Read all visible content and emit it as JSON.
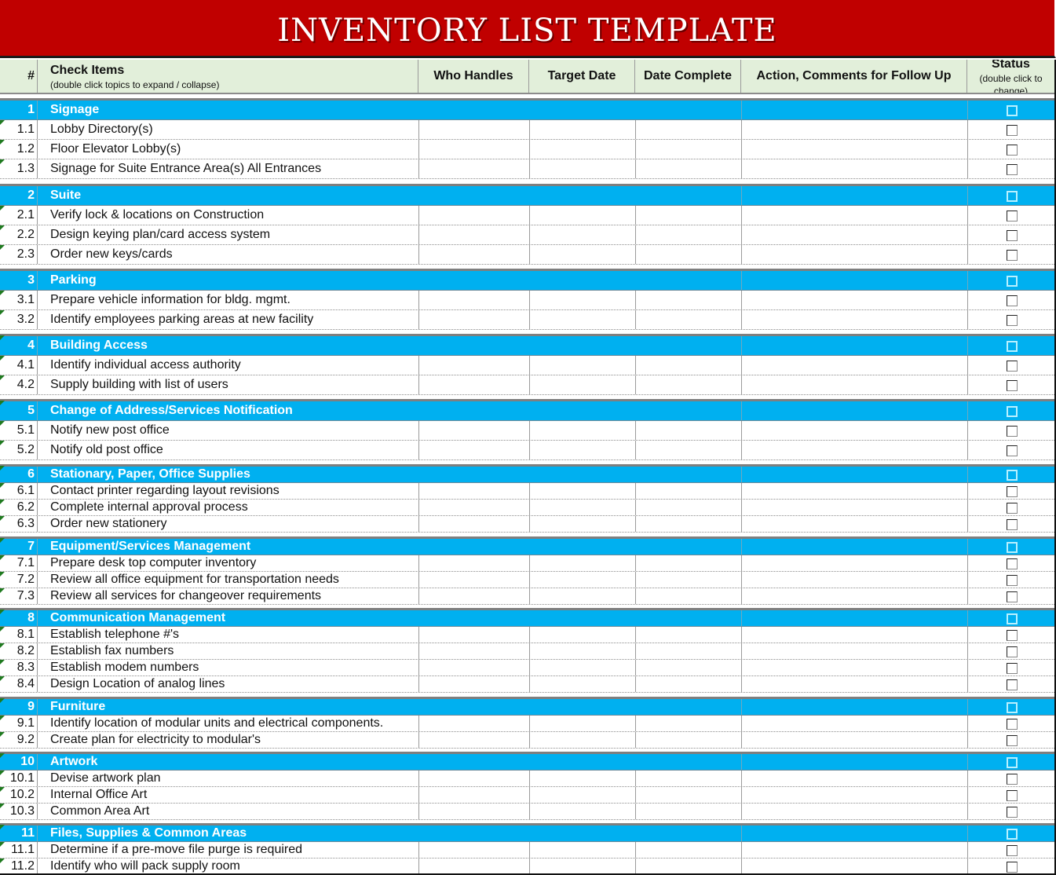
{
  "title": "INVENTORY LIST TEMPLATE",
  "header": {
    "num": "#",
    "check_items": "Check Items",
    "check_items_hint": "(double click topics to expand / collapse)",
    "who_handles": "Who Handles",
    "target_date": "Target Date",
    "date_complete": "Date Complete",
    "action": "Action, Comments for Follow Up",
    "status": "Status",
    "status_hint": "(double click to change)"
  },
  "colors": {
    "title_band": "#C00000",
    "header_bg": "#E2EFDA",
    "section_bg": "#00B0F0",
    "comment_marker": "#1F7A1F"
  },
  "sections": [
    {
      "num": "1",
      "name": "Signage",
      "checked": false,
      "items": [
        {
          "num": "1.1",
          "text": "Lobby Directory(s)",
          "checked": false
        },
        {
          "num": "1.2",
          "text": "Floor Elevator Lobby(s)",
          "checked": false
        },
        {
          "num": "1.3",
          "text": "Signage for Suite Entrance Area(s) All Entrances",
          "checked": false
        }
      ]
    },
    {
      "num": "2",
      "name": "Suite",
      "checked": false,
      "items": [
        {
          "num": "2.1",
          "text": "Verify lock & locations on Construction",
          "checked": false
        },
        {
          "num": "2.2",
          "text": "Design keying plan/card access system",
          "checked": false
        },
        {
          "num": "2.3",
          "text": "Order new keys/cards",
          "checked": false
        }
      ]
    },
    {
      "num": "3",
      "name": "Parking",
      "checked": false,
      "items": [
        {
          "num": "3.1",
          "text": "Prepare vehicle information for bldg. mgmt.",
          "checked": false
        },
        {
          "num": "3.2",
          "text": "Identify employees parking areas at new facility",
          "checked": false
        }
      ]
    },
    {
      "num": "4",
      "name": "Building Access",
      "checked": false,
      "items": [
        {
          "num": "4.1",
          "text": "Identify individual access authority",
          "checked": false
        },
        {
          "num": "4.2",
          "text": "Supply building with list of users",
          "checked": false
        }
      ]
    },
    {
      "num": "5",
      "name": "Change of Address/Services Notification",
      "checked": false,
      "items": [
        {
          "num": "5.1",
          "text": "Notify new post office",
          "checked": false
        },
        {
          "num": "5.2",
          "text": "Notify old post office",
          "checked": false
        }
      ]
    },
    {
      "num": "6",
      "name": "Stationary, Paper, Office Supplies",
      "checked": false,
      "items": [
        {
          "num": "6.1",
          "text": "Contact printer regarding layout revisions",
          "checked": false
        },
        {
          "num": "6.2",
          "text": "Complete internal approval process",
          "checked": false
        },
        {
          "num": "6.3",
          "text": "Order new stationery",
          "checked": false
        }
      ]
    },
    {
      "num": "7",
      "name": "Equipment/Services Management",
      "checked": false,
      "items": [
        {
          "num": "7.1",
          "text": "Prepare desk top computer inventory",
          "checked": false
        },
        {
          "num": "7.2",
          "text": "Review all office equipment for transportation needs",
          "checked": false
        },
        {
          "num": "7.3",
          "text": "Review all services for changeover requirements",
          "checked": false
        }
      ]
    },
    {
      "num": "8",
      "name": "Communication Management",
      "checked": false,
      "items": [
        {
          "num": "8.1",
          "text": "Establish telephone #'s",
          "checked": false
        },
        {
          "num": "8.2",
          "text": "Establish fax numbers",
          "checked": false
        },
        {
          "num": "8.3",
          "text": "Establish modem numbers",
          "checked": false
        },
        {
          "num": "8.4",
          "text": "Design Location of analog lines",
          "checked": false
        }
      ]
    },
    {
      "num": "9",
      "name": "Furniture",
      "checked": false,
      "items": [
        {
          "num": "9.1",
          "text": "Identify location of modular units and electrical components.",
          "checked": false
        },
        {
          "num": "9.2",
          "text": "Create plan for electricity to modular's",
          "checked": false
        }
      ]
    },
    {
      "num": "10",
      "name": "Artwork",
      "checked": false,
      "items": [
        {
          "num": "10.1",
          "text": "Devise artwork plan",
          "checked": false
        },
        {
          "num": "10.2",
          "text": "Internal Office Art",
          "checked": false
        },
        {
          "num": "10.3",
          "text": "Common Area Art",
          "checked": false
        }
      ]
    },
    {
      "num": "11",
      "name": "Files, Supplies & Common Areas",
      "checked": false,
      "items": [
        {
          "num": "11.1",
          "text": "Determine if a pre-move file purge is required",
          "checked": false
        },
        {
          "num": "11.2",
          "text": "Identify who will pack supply room",
          "checked": false
        }
      ]
    }
  ]
}
